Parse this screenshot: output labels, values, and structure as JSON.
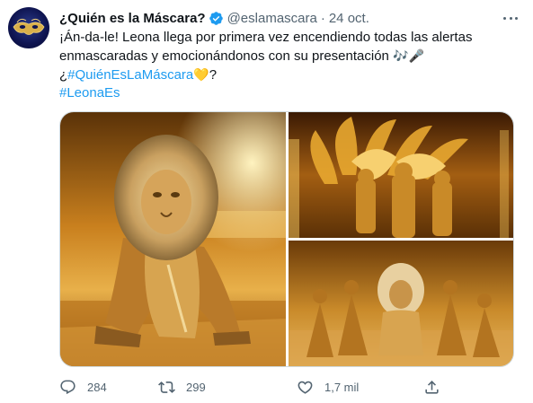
{
  "tweet": {
    "display_name": "¿Quién es la Máscara?",
    "handle": "@eslamascara",
    "separator": "·",
    "date": "24 oct.",
    "text_line1": "¡Án-da-le! Leona llega por primera vez encendiendo todas las alertas",
    "text_line2": "enmascaradas y emocionándonos con su presentación ",
    "text_line2_emoji": "🎶🎤",
    "text_line3_prefix": "¿",
    "hashtag1": "#QuiénEsLaMáscara",
    "hashtag1_emoji": "💛",
    "text_line3_suffix": "?",
    "hashtag2": "#LeonaEs"
  },
  "actions": {
    "replies": "284",
    "retweets": "299",
    "likes": "1,7 mil"
  },
  "icons": {
    "verified": "verified-badge-icon",
    "more": "more-icon",
    "reply": "reply-icon",
    "retweet": "retweet-icon",
    "like": "heart-icon",
    "share": "share-icon"
  },
  "colors": {
    "link": "#1d9bf0",
    "secondary_text": "#536471",
    "primary_text": "#0f1419",
    "verified": "#1d9bf0"
  }
}
